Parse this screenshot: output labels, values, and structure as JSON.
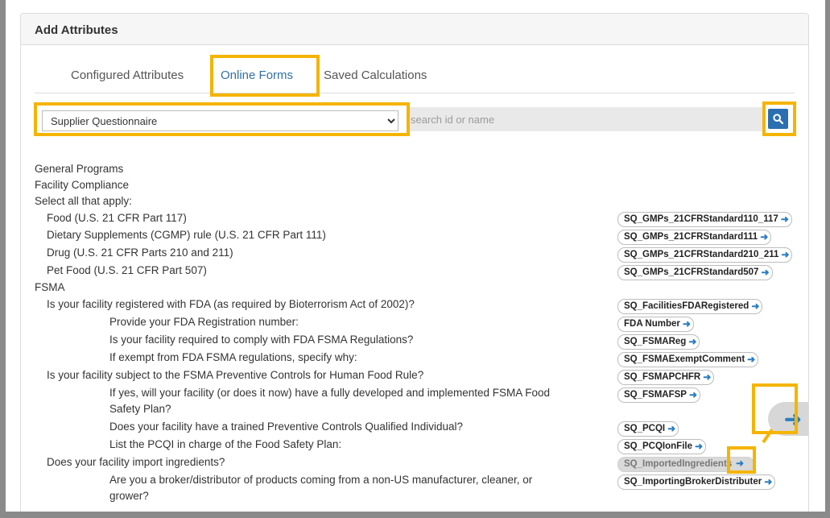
{
  "panel": {
    "title": "Add Attributes"
  },
  "tabs": [
    {
      "label": "Configured Attributes",
      "active": false
    },
    {
      "label": "Online Forms",
      "active": true
    },
    {
      "label": "Saved Calculations",
      "active": false
    }
  ],
  "form_select": {
    "selected": "Supplier Questionnaire"
  },
  "search": {
    "placeholder": "search id or name",
    "icon": "search-icon"
  },
  "lines": [
    "General Programs",
    "Facility Compliance",
    "Select all that apply:",
    "Food (U.S. 21 CFR Part 117)",
    "Dietary Supplements (CGMP) rule (U.S. 21 CFR Part 111)",
    "Drug (U.S. 21 CFR Parts 210 and 211)",
    "Pet Food (U.S. 21 CFR Part 507)",
    "FSMA",
    "Is your facility registered with FDA (as required by Bioterrorism Act of 2002)?",
    "Provide your FDA Registration number:",
    "Is your facility required to comply with FDA FSMA Regulations?",
    "If exempt from FDA FSMA regulations, specify why:",
    "Is your facility subject to the FSMA Preventive Controls for Human Food Rule?",
    "If yes, will your facility (or does it now) have a fully developed and implemented FSMA Food",
    "Safety Plan?",
    "Does your facility have a trained Preventive Controls Qualified Individual?",
    "List the PCQI in charge of the Food Safety Plan:",
    "Does your facility import ingredients?",
    "Are you a broker/distributor of products coming from a non-US manufacturer, cleaner, or",
    "grower?"
  ],
  "attributes": [
    "SQ_GMPs_21CFRStandard110_117",
    "SQ_GMPs_21CFRStandard111",
    "SQ_GMPs_21CFRStandard210_211",
    "SQ_GMPs_21CFRStandard507",
    "SQ_FacilitiesFDARegistered",
    "FDA Number",
    "SQ_FSMAReg",
    "SQ_FSMAExemptComment",
    "SQ_FSMAPCHFR",
    "SQ_FSMAFSP",
    "SQ_PCQI",
    "SQ_PCQIonFile",
    "SQ_ImportedIngredients",
    "SQ_ImportingBrokerDistributer"
  ],
  "arrow_glyph": "➜",
  "highlight_color": "#f5b400"
}
